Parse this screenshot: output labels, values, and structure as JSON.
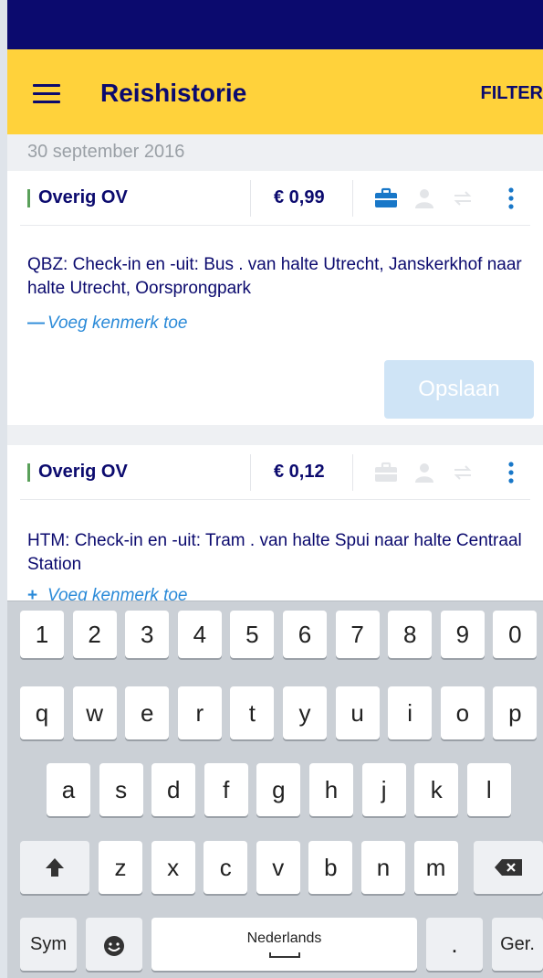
{
  "app": {
    "title": "Reishistorie",
    "filter_label": "FILTER",
    "colors": {
      "navy": "#0b0a6e",
      "yellow": "#ffd23b",
      "link_blue": "#2a8ad8",
      "accent_green": "#5aa05a"
    }
  },
  "date_header": "30 september 2016",
  "trips": [
    {
      "category": "Overig OV",
      "price": "€ 0,99",
      "description": "QBZ: Check-in en -uit: Bus . van halte Utrecht, Janskerkhof naar halte Utrecht, Oorsprongpark",
      "add_symbol": "—",
      "add_label": "Voeg kenmerk toe",
      "save_label": "Opslaan",
      "icons": [
        "briefcase-icon",
        "person-icon",
        "swap-icon",
        "more-vert-icon"
      ],
      "business_active": true
    },
    {
      "category": "Overig OV",
      "price": "€ 0,12",
      "description": "HTM: Check-in en -uit: Tram . van halte Spui naar halte Centraal Station",
      "add_symbol": "+",
      "add_label": "Voeg kenmerk toe",
      "icons": [
        "briefcase-icon",
        "person-icon",
        "swap-icon",
        "more-vert-icon"
      ],
      "business_active": false
    }
  ],
  "keyboard": {
    "numbers": [
      "1",
      "2",
      "3",
      "4",
      "5",
      "6",
      "7",
      "8",
      "9",
      "0"
    ],
    "row1": [
      "q",
      "w",
      "e",
      "r",
      "t",
      "y",
      "u",
      "i",
      "o",
      "p"
    ],
    "row2": [
      "a",
      "s",
      "d",
      "f",
      "g",
      "h",
      "j",
      "k",
      "l"
    ],
    "row3": [
      "z",
      "x",
      "c",
      "v",
      "b",
      "n",
      "m"
    ],
    "sym_label": "Sym",
    "space_label": "Nederlands",
    "period_label": ".",
    "enter_label": "Ger."
  }
}
